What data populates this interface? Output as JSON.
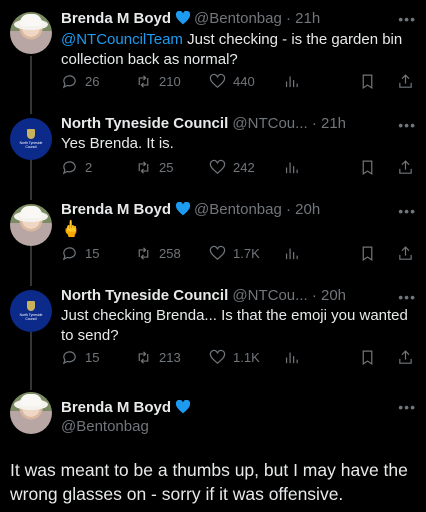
{
  "tweets": [
    {
      "name": "Brenda M Boyd",
      "handle": "@Bentonbag",
      "time": "· 21h",
      "mention": "@NTCouncilTeam",
      "text": " Just checking - is the garden bin collection back as normal?",
      "replies": "26",
      "retweets": "210",
      "likes": "440"
    },
    {
      "name": "North Tyneside Council",
      "handle": "@NTCou...",
      "time": "· 21h",
      "avatar_text": "North Tyneside\nCouncil",
      "text": "Yes Brenda. It is.",
      "replies": "2",
      "retweets": "25",
      "likes": "242"
    },
    {
      "name": "Brenda M Boyd",
      "handle": "@Bentonbag",
      "time": "· 20h",
      "text": "🖕",
      "replies": "15",
      "retweets": "258",
      "likes": "1.7K"
    },
    {
      "name": "North Tyneside Council",
      "handle": "@NTCou...",
      "time": "· 20h",
      "avatar_text": "North Tyneside\nCouncil",
      "text": "Just checking Brenda... Is that the emoji you wanted to send?",
      "replies": "15",
      "retweets": "213",
      "likes": "1.1K"
    }
  ],
  "final": {
    "name": "Brenda M Boyd",
    "handle": "@Bentonbag",
    "text": "It was meant to be a thumbs up, but I may have the wrong glasses on - sorry if it was offensive."
  },
  "more_label": "•••",
  "colors": {
    "background": "#000000",
    "text": "#e7e9ea",
    "muted": "#71767b",
    "accent": "#1d9bf0"
  }
}
